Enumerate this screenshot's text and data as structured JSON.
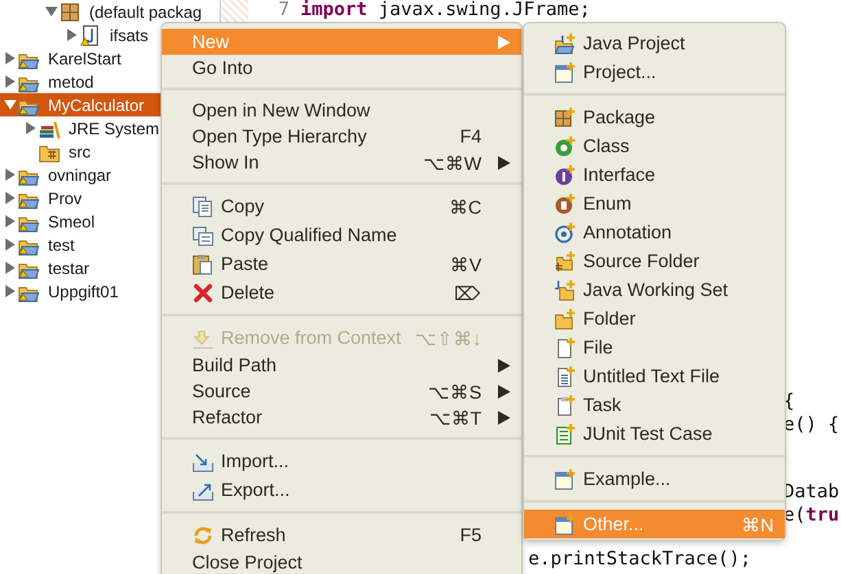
{
  "tree": {
    "items": [
      {
        "children": [
          {
            "children": [
              {
                "label": "(default packag",
                "kind": "package",
                "expanded": true,
                "selected": false,
                "children": [
                  {
                    "label": "ifsats",
                    "kind": "java-file",
                    "expanded": false,
                    "selected": false
                  }
                ]
              }
            ]
          }
        ]
      },
      {
        "label": "KarelStart",
        "kind": "project",
        "expanded": false,
        "selected": false
      },
      {
        "label": "metod",
        "kind": "project",
        "expanded": false,
        "selected": false
      },
      {
        "label": "MyCalculator",
        "kind": "project",
        "expanded": true,
        "selected": true,
        "children": [
          {
            "label": "JRE System",
            "kind": "library",
            "expanded": false,
            "selected": false
          },
          {
            "label": "src",
            "kind": "source-folder",
            "selected": false
          }
        ]
      },
      {
        "label": "ovningar",
        "kind": "project",
        "expanded": false,
        "selected": false
      },
      {
        "label": "Prov",
        "kind": "project",
        "expanded": false,
        "selected": false
      },
      {
        "label": "Smeol",
        "kind": "project",
        "expanded": false,
        "selected": false
      },
      {
        "label": "test",
        "kind": "project",
        "expanded": false,
        "selected": false
      },
      {
        "label": "testar",
        "kind": "project",
        "expanded": false,
        "selected": false
      },
      {
        "label": "Uppgift01",
        "kind": "project",
        "expanded": false,
        "selected": false
      }
    ]
  },
  "editor": {
    "top_line": {
      "number": "7",
      "segments": [
        {
          "text": "import",
          "kind": "keyword"
        },
        {
          "text": " javax.swing.JFrame;",
          "kind": "plain"
        }
      ]
    },
    "fragment_groups": [
      [
        {
          "kind": "tail",
          "segments": [
            {
              "text": "{",
              "kind": "plain"
            }
          ]
        },
        {
          "kind": "tail",
          "segments": [
            {
              "text": "e() {",
              "kind": "plain"
            }
          ]
        }
      ],
      [
        {
          "kind": "tail",
          "segments": [
            {
              "text": "Datab",
              "kind": "plain"
            }
          ]
        },
        {
          "kind": "tail",
          "segments": [
            {
              "text": "e(",
              "kind": "plain"
            },
            {
              "text": "tru",
              "kind": "keyword"
            }
          ]
        }
      ],
      [
        {
          "kind": "cut",
          "segments": [
            {
              "text": "e.printStackTrace();",
              "kind": "plain"
            }
          ]
        }
      ]
    ]
  },
  "context_menu": {
    "groups": [
      [
        {
          "label": "New",
          "submenu": true,
          "selected": true,
          "disabled": false
        },
        {
          "label": "Go Into",
          "submenu": false,
          "selected": false,
          "disabled": false
        }
      ],
      [
        {
          "label": "Open in New Window",
          "submenu": false,
          "selected": false,
          "disabled": false
        },
        {
          "label": "Open Type Hierarchy",
          "shortcut": "F4",
          "submenu": false,
          "selected": false,
          "disabled": false
        },
        {
          "label": "Show In",
          "shortcut": "⌥⌘W",
          "submenu": true,
          "selected": false,
          "disabled": false
        }
      ],
      [
        {
          "label": "Copy",
          "shortcut": "⌘C",
          "submenu": false,
          "selected": false,
          "disabled": false
        },
        {
          "label": "Copy Qualified Name",
          "submenu": false,
          "selected": false,
          "disabled": false
        },
        {
          "label": "Paste",
          "shortcut": "⌘V",
          "submenu": false,
          "selected": false,
          "disabled": false
        },
        {
          "label": "Delete",
          "shortcut": "⌦",
          "submenu": false,
          "selected": false,
          "disabled": false
        }
      ],
      [
        {
          "label": "Remove from Context",
          "shortcut": "⌥⇧⌘↓",
          "submenu": false,
          "selected": false,
          "disabled": true
        },
        {
          "label": "Build Path",
          "submenu": true,
          "selected": false,
          "disabled": false
        },
        {
          "label": "Source",
          "shortcut": "⌥⌘S",
          "submenu": true,
          "selected": false,
          "disabled": false
        },
        {
          "label": "Refactor",
          "shortcut": "⌥⌘T",
          "submenu": true,
          "selected": false,
          "disabled": false
        }
      ],
      [
        {
          "label": "Import...",
          "submenu": false,
          "selected": false,
          "disabled": false
        },
        {
          "label": "Export...",
          "submenu": false,
          "selected": false,
          "disabled": false
        }
      ],
      [
        {
          "label": "Refresh",
          "shortcut": "F5",
          "submenu": false,
          "selected": false,
          "disabled": false
        },
        {
          "label": "Close Project",
          "submenu": false,
          "selected": false,
          "disabled": false
        }
      ]
    ]
  },
  "submenu": {
    "groups": [
      [
        {
          "label": "Java Project",
          "selected": false
        },
        {
          "label": "Project...",
          "selected": false
        }
      ],
      [
        {
          "label": "Package",
          "selected": false
        },
        {
          "label": "Class",
          "selected": false
        },
        {
          "label": "Interface",
          "selected": false
        },
        {
          "label": "Enum",
          "selected": false
        },
        {
          "label": "Annotation",
          "selected": false
        },
        {
          "label": "Source Folder",
          "selected": false
        },
        {
          "label": "Java Working Set",
          "selected": false
        },
        {
          "label": "Folder",
          "selected": false
        },
        {
          "label": "File",
          "selected": false
        },
        {
          "label": "Untitled Text File",
          "selected": false
        },
        {
          "label": "Task",
          "selected": false
        },
        {
          "label": "JUnit Test Case",
          "selected": false
        }
      ],
      [
        {
          "label": "Example...",
          "selected": false
        }
      ],
      [
        {
          "label": "Other...",
          "shortcut": "⌘N",
          "selected": true
        }
      ]
    ]
  }
}
